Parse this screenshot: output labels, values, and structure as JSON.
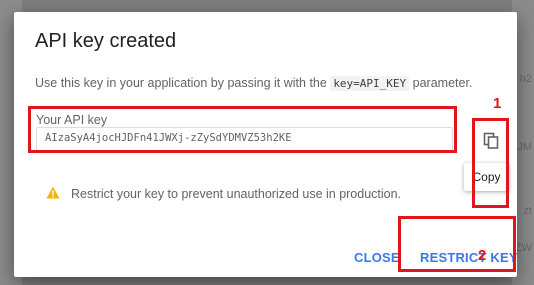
{
  "dialog": {
    "title": "API key created",
    "description_prefix": "Use this key in your application by passing it with the",
    "description_code": "key=API_KEY",
    "description_suffix": "parameter.",
    "field_label": "Your API key",
    "api_key": "AIzaSyA4jocHJDFn41JWXj-zZySdYDMVZ53h2KE",
    "copy_tooltip": "Copy",
    "warning_text": "Restrict your key to prevent unauthorized use in production.",
    "close_label": "CLOSE",
    "restrict_label": "RESTRICT KEY"
  },
  "annotations": {
    "label_1": "1",
    "label_2": "2"
  },
  "background": {
    "right_fragments": [
      "h2",
      "JM",
      "zt",
      "ZW"
    ]
  },
  "colors": {
    "accent": "#3b78e7",
    "annotation": "#e0161e",
    "warning": "#f4b400"
  }
}
